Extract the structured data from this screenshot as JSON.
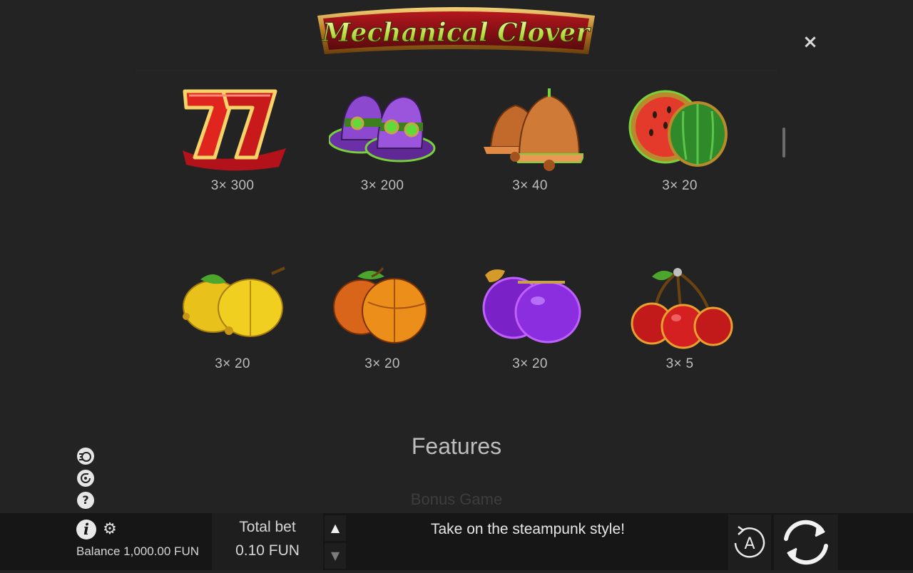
{
  "game": {
    "title": "Mechanical Clover",
    "close_symbol": "×"
  },
  "paytable": {
    "symbols": [
      {
        "name": "sevens",
        "icon": "double-seven-icon",
        "payout": "3× 300"
      },
      {
        "name": "top-hats",
        "icon": "steampunk-hat-icon",
        "payout": "3× 200"
      },
      {
        "name": "bells",
        "icon": "bells-icon",
        "payout": "3× 40"
      },
      {
        "name": "watermelon",
        "icon": "watermelon-icon",
        "payout": "3× 20"
      },
      {
        "name": "lemon",
        "icon": "lemon-icon",
        "payout": "3× 20"
      },
      {
        "name": "orange",
        "icon": "orange-icon",
        "payout": "3× 20"
      },
      {
        "name": "plum",
        "icon": "plum-icon",
        "payout": "3× 20"
      },
      {
        "name": "cherry",
        "icon": "cherry-icon",
        "payout": "3× 5"
      }
    ]
  },
  "features": {
    "title": "Features",
    "next_heading": "Bonus Game"
  },
  "side_icons": [
    "turbo-icon",
    "history-icon",
    "help-icon"
  ],
  "bottom_bar": {
    "info_label": "i",
    "balance_label": "Balance 1,000.00 FUN",
    "total_bet_label": "Total bet",
    "total_bet_value": "0.10 FUN",
    "message": "Take on the steampunk style!",
    "autoplay_label": "A"
  },
  "colors": {
    "background": "#232323",
    "bar": "#161616",
    "logo_red": "#8e1116",
    "logo_gold": "#d9a23b",
    "logo_text": "#c8e24a"
  }
}
